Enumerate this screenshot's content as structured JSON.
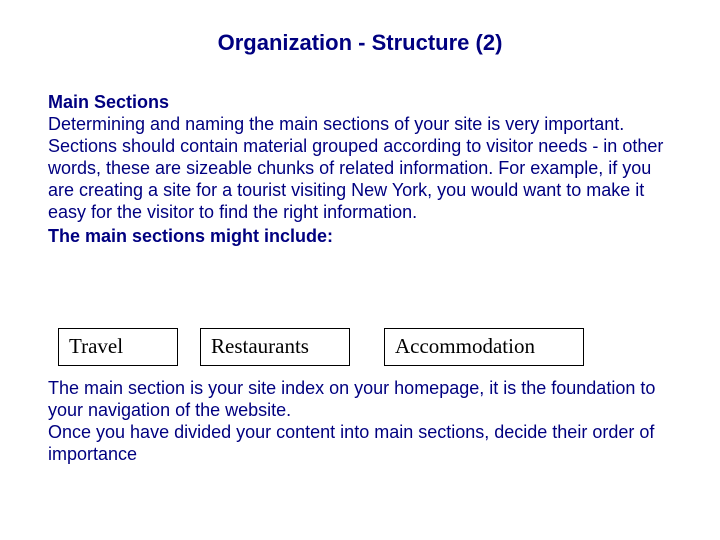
{
  "title": "Organization - Structure (2)",
  "subhead": "Main Sections",
  "paragraph": "Determining and naming the main sections of your site is very important. Sections should contain material grouped according to visitor needs - in other words, these are sizeable chunks of related information. For example, if you are creating a site for a tourist visiting New York, you would want to make it easy for the visitor to find the right information.",
  "lead_in": "The main sections might include:",
  "boxes": {
    "b1": "Travel",
    "b2": "Restaurants",
    "b3": "Accommodation"
  },
  "footer1": "The main section is your site index on your homepage, it is the foundation to your navigation of the website.",
  "footer2": "Once you have divided your content into main sections, decide their order of importance"
}
